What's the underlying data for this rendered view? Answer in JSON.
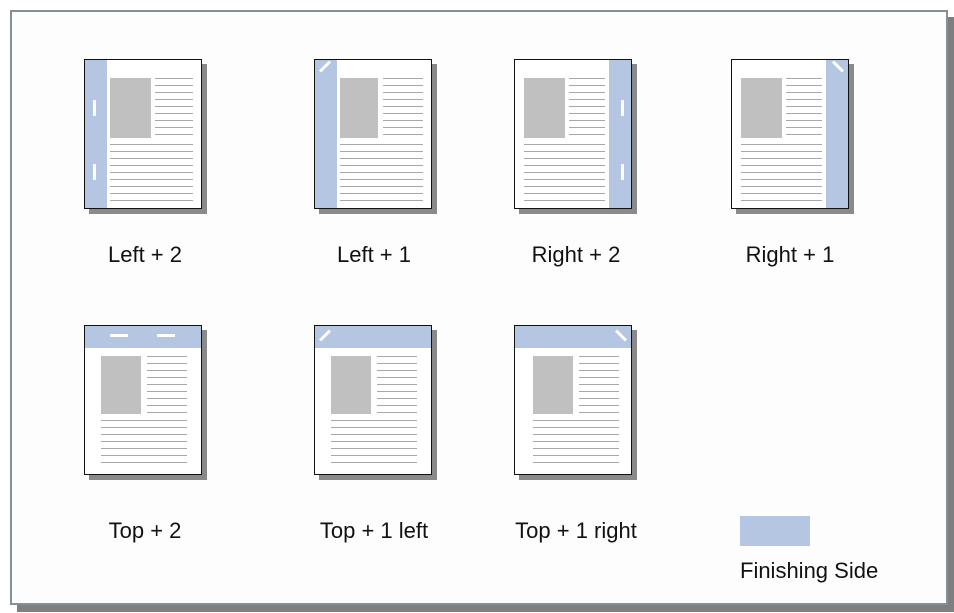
{
  "colors": {
    "finishing": "#b4c6e2",
    "frame_border": "#858f98"
  },
  "items": [
    {
      "label": "Left + 2"
    },
    {
      "label": "Left + 1"
    },
    {
      "label": "Right + 2"
    },
    {
      "label": "Right + 1"
    },
    {
      "label": "Top + 2"
    },
    {
      "label": "Top + 1 left"
    },
    {
      "label": "Top + 1 right"
    }
  ],
  "legend": {
    "label": "Finishing Side"
  }
}
